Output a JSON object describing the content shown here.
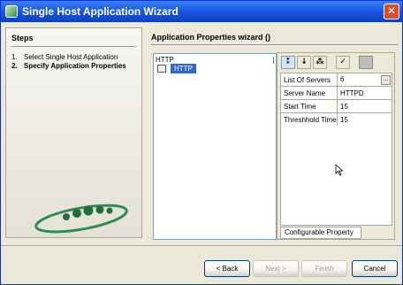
{
  "window": {
    "title": "Single Host Application Wizard",
    "close_glyph": "✕"
  },
  "steps": {
    "heading": "Steps",
    "items": [
      {
        "num": "1.",
        "label": "Select Single Host Application",
        "active": false
      },
      {
        "num": "2.",
        "label": "Specify Application Properties",
        "active": true
      }
    ]
  },
  "main": {
    "title": "Application Properties wizard ()"
  },
  "tree": {
    "root": "HTTP",
    "node": "HTTP"
  },
  "toolbar": {
    "buttons": [
      {
        "icon": "sort-category-icon",
        "glyph": "⁑"
      },
      {
        "icon": "sort-alpha-icon",
        "glyph": "↓"
      },
      {
        "icon": "sort-custom-icon",
        "glyph": "⁂"
      },
      {
        "icon": "edit-properties-icon",
        "glyph": "✓"
      },
      {
        "icon": "stop-icon",
        "glyph": ""
      }
    ]
  },
  "properties": {
    "rows": [
      {
        "name": "List Of Servers",
        "value": "6",
        "ellipsis": "..."
      },
      {
        "name": "Server Name",
        "value": "HTTPD"
      },
      {
        "name": "Start Time",
        "value": "15"
      },
      {
        "name": "Threshhold Time",
        "value": "15"
      }
    ],
    "tab_label": "Configurable Property"
  },
  "buttons": {
    "back": "< Back",
    "next": "Next >",
    "finish": "Finish",
    "cancel": "Cancel"
  },
  "colors": {
    "title_bar": "#1c5ae3",
    "selection": "#316ac5",
    "logo_green": "#2e8b57"
  }
}
